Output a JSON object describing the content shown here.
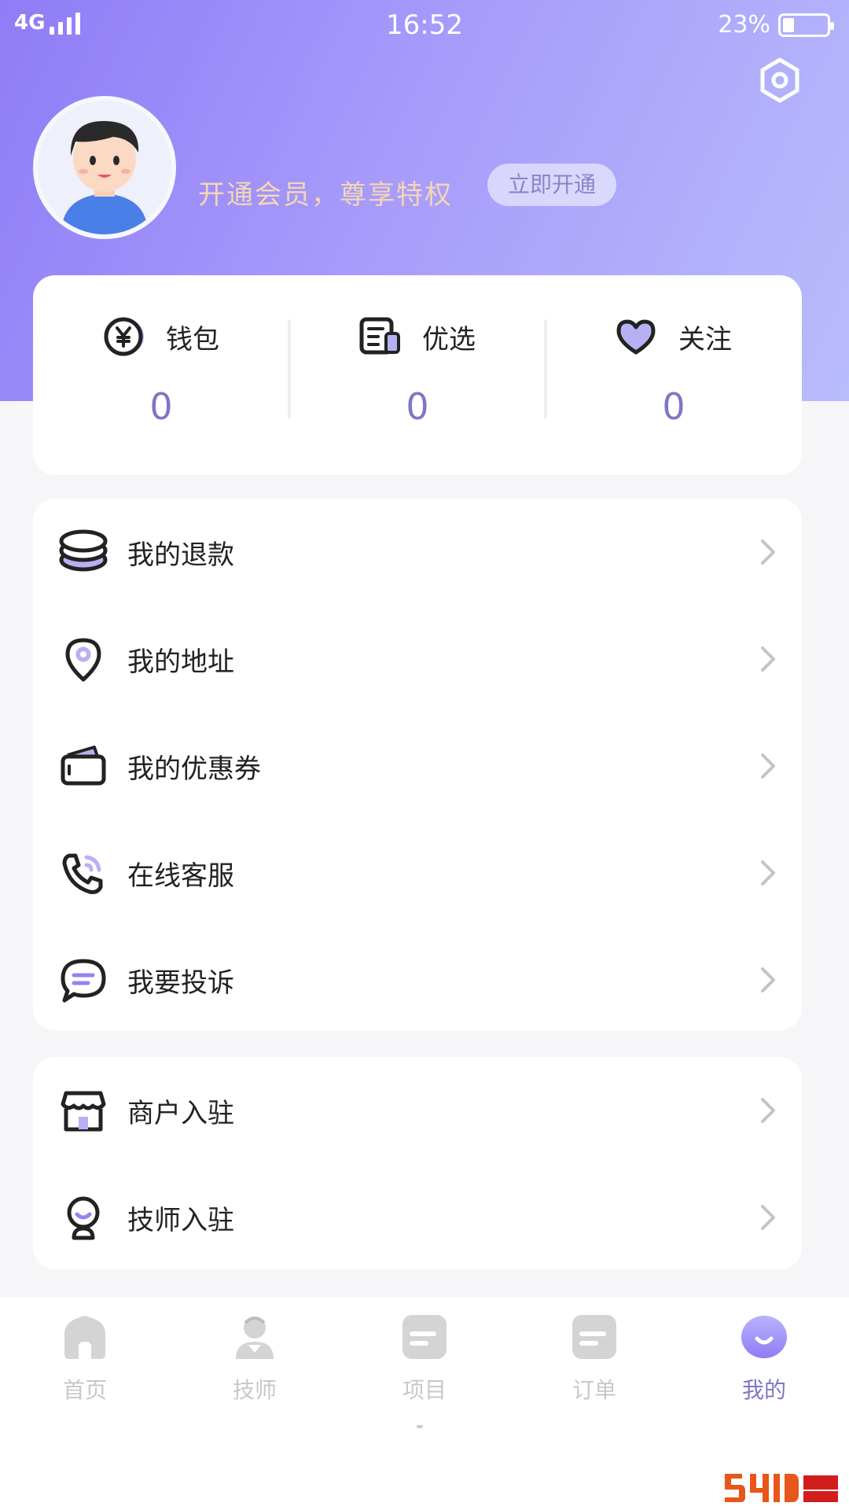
{
  "status_bar": {
    "network": "4G",
    "time": "16:52",
    "battery": "23%"
  },
  "profile": {
    "vip_text": "开通会员，尊享特权",
    "vip_button": "立即开通"
  },
  "stats": [
    {
      "label": "钱包",
      "value": "0",
      "icon": "yen-coin-icon"
    },
    {
      "label": "优选",
      "value": "0",
      "icon": "document-icon"
    },
    {
      "label": "关注",
      "value": "0",
      "icon": "heart-icon"
    }
  ],
  "menu_main": [
    {
      "label": "我的退款",
      "icon": "coin-stack-icon"
    },
    {
      "label": "我的地址",
      "icon": "location-pin-icon"
    },
    {
      "label": "我的优惠券",
      "icon": "coupon-icon"
    },
    {
      "label": "在线客服",
      "icon": "phone-icon"
    },
    {
      "label": "我要投诉",
      "icon": "chat-bubble-icon"
    }
  ],
  "menu_join": [
    {
      "label": "商户入驻",
      "icon": "store-icon"
    },
    {
      "label": "技师入驻",
      "icon": "technician-icon"
    }
  ],
  "tabs": [
    {
      "label": "首页",
      "icon": "home-icon"
    },
    {
      "label": "技师",
      "icon": "person-icon"
    },
    {
      "label": "项目",
      "icon": "project-icon"
    },
    {
      "label": "订单",
      "icon": "order-icon"
    },
    {
      "label": "我的",
      "icon": "smile-icon",
      "active": true
    }
  ],
  "colors": {
    "accent": "#7c78c4",
    "header_gradient_start": "#8f7cf7",
    "header_gradient_end": "#b9bcfb",
    "vip_text": "#f3d6b6"
  }
}
